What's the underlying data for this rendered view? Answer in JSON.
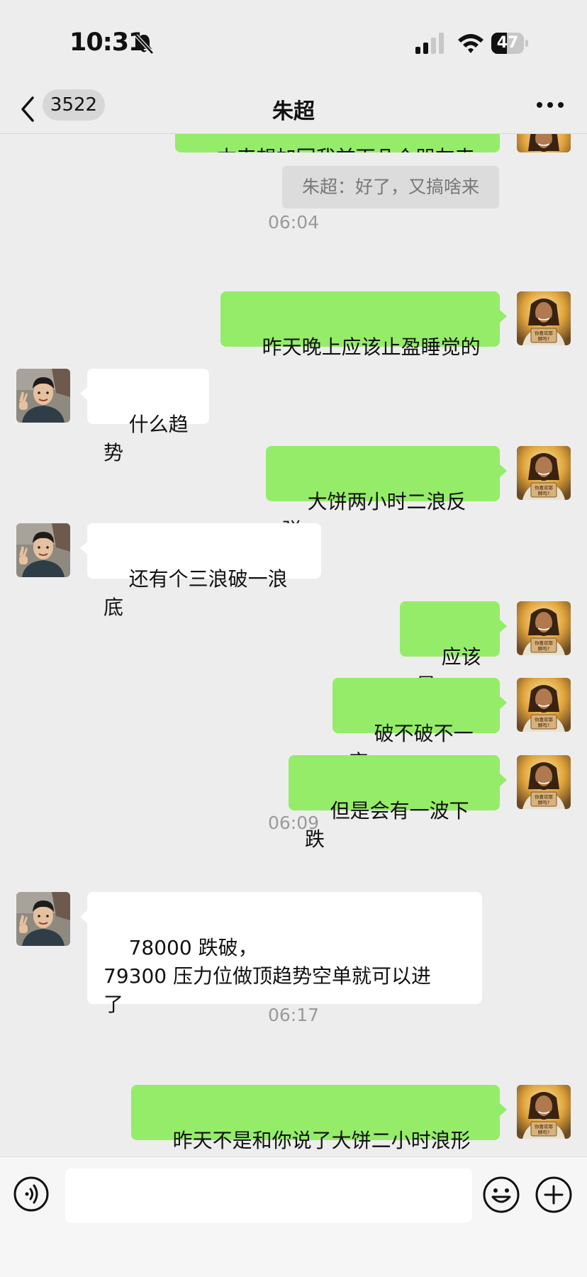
{
  "status_bar": {
    "time": "10:31",
    "battery": "47",
    "battery_level": 0.47,
    "icons": [
      "bell-slash-icon",
      "signal-icon",
      "wifi-icon",
      "battery-icon"
    ]
  },
  "nav": {
    "back_icon": "chevron-left-icon",
    "unread_count": "3522",
    "title": "朱超",
    "more_icon": "more-icon"
  },
  "chat": {
    "partial_message": "本来想加回我前面几个朋友来",
    "system_message": "朱超：好了，又搞啥来",
    "timestamps": [
      "06:04",
      "06:09",
      "06:17"
    ],
    "messages": [
      {
        "sender": "me",
        "text": "昨天晚上应该止盈睡觉的"
      },
      {
        "sender": "other",
        "text": "什么趋势"
      },
      {
        "sender": "me",
        "text": "大饼两小时二浪反弹"
      },
      {
        "sender": "other",
        "text": "还有个三浪破一浪底"
      },
      {
        "sender": "me",
        "text": "应该是"
      },
      {
        "sender": "me",
        "text": "破不破不一定"
      },
      {
        "sender": "me",
        "text": "但是会有一波下跌"
      },
      {
        "sender": "other",
        "text": "78000 跌破，\n79300 压力位做顶趋势空单就可以进\n了"
      },
      {
        "sender": "me",
        "text": "昨天不是和你说了大饼二小时浪形"
      }
    ],
    "my_avatar_sign": "你喜欢耶稣吗？"
  },
  "input_bar": {
    "voice_icon": "voice-icon",
    "emoji_icon": "emoji-icon",
    "plus_icon": "plus-icon",
    "placeholder": ""
  },
  "colors": {
    "background": "#ededed",
    "my_bubble": "#95ec69",
    "other_bubble": "#ffffff",
    "timestamp": "#9a9a9a"
  }
}
